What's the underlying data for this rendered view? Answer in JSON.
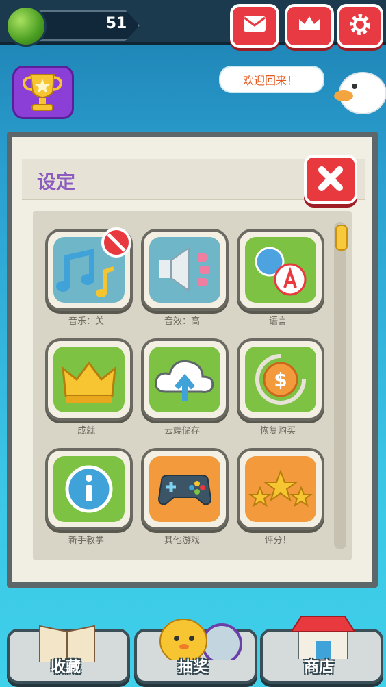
{
  "top": {
    "level": "51"
  },
  "greeting": "欢迎回来！",
  "panel": {
    "title": "设定"
  },
  "settings": [
    {
      "label": "音乐：关",
      "icon": "music-off-icon"
    },
    {
      "label": "音效：高",
      "icon": "speaker-icon"
    },
    {
      "label": "语言",
      "icon": "language-icon"
    },
    {
      "label": "成就",
      "icon": "crown-icon"
    },
    {
      "label": "云端储存",
      "icon": "cloud-upload-icon"
    },
    {
      "label": "恢复购买",
      "icon": "restore-purchase-icon"
    },
    {
      "label": "新手教学",
      "icon": "info-icon"
    },
    {
      "label": "其他游戏",
      "icon": "gamepad-icon"
    },
    {
      "label": "评分！",
      "icon": "stars-icon"
    }
  ],
  "bottom": {
    "collection": "收藏",
    "lottery": "抽奖",
    "shop": "商店"
  },
  "colors": {
    "accent_red": "#e8393f",
    "title_purple": "#8b5bbf",
    "tile_green": "#7dc243",
    "tile_orange": "#f29a3c",
    "tile_blue": "#6fb6c8"
  }
}
